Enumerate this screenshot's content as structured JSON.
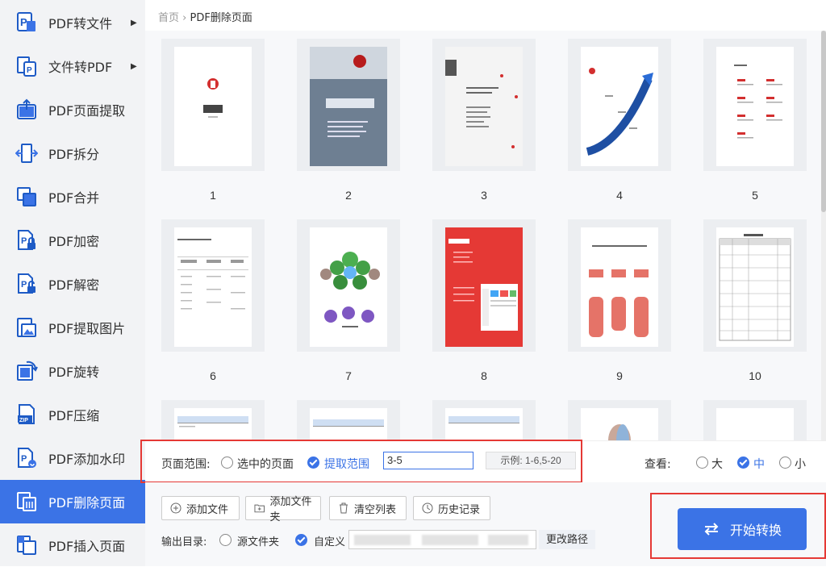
{
  "sidebar": {
    "items": [
      {
        "label": "PDF转文件",
        "icon": "pdf-to-file-icon",
        "has_arrow": true,
        "active": false
      },
      {
        "label": "文件转PDF",
        "icon": "file-to-pdf-icon",
        "has_arrow": true,
        "active": false
      },
      {
        "label": "PDF页面提取",
        "icon": "page-extract-icon",
        "has_arrow": false,
        "active": false
      },
      {
        "label": "PDF拆分",
        "icon": "split-icon",
        "has_arrow": false,
        "active": false
      },
      {
        "label": "PDF合并",
        "icon": "merge-icon",
        "has_arrow": false,
        "active": false
      },
      {
        "label": "PDF加密",
        "icon": "lock-icon",
        "has_arrow": false,
        "active": false
      },
      {
        "label": "PDF解密",
        "icon": "unlock-icon",
        "has_arrow": false,
        "active": false
      },
      {
        "label": "PDF提取图片",
        "icon": "image-extract-icon",
        "has_arrow": false,
        "active": false
      },
      {
        "label": "PDF旋转",
        "icon": "rotate-icon",
        "has_arrow": false,
        "active": false
      },
      {
        "label": "PDF压缩",
        "icon": "zip-icon",
        "has_arrow": false,
        "active": false
      },
      {
        "label": "PDF添加水印",
        "icon": "watermark-icon",
        "has_arrow": false,
        "active": false
      },
      {
        "label": "PDF删除页面",
        "icon": "delete-page-icon",
        "has_arrow": false,
        "active": true
      },
      {
        "label": "PDF插入页面",
        "icon": "insert-page-icon",
        "has_arrow": false,
        "active": false
      }
    ],
    "arrow_glyph": "▶"
  },
  "breadcrumb": {
    "home": "首页",
    "separator": "›",
    "current": "PDF删除页面"
  },
  "pages": [
    "1",
    "2",
    "3",
    "4",
    "5",
    "6",
    "7",
    "8",
    "9",
    "10"
  ],
  "options": {
    "range_label": "页面范围:",
    "selected_pages_label": "选中的页面",
    "extract_range_label": "提取范围",
    "range_value": "3-5",
    "example_text": "示例: 1-6,5-20",
    "view_label": "查看:",
    "view_options": [
      "大",
      "中",
      "小"
    ],
    "view_selected": "中"
  },
  "toolbar": {
    "add_file": "添加文件",
    "add_folder": "添加文件夹",
    "clear_list": "清空列表",
    "history": "历史记录"
  },
  "output": {
    "label": "输出目录:",
    "source_folder": "源文件夹",
    "custom": "自定义",
    "change_path": "更改路径"
  },
  "start_button": "开始转换",
  "colors": {
    "accent": "#3b73e6",
    "highlight": "#e53935",
    "sidebar_bg": "#f2f3f5"
  }
}
